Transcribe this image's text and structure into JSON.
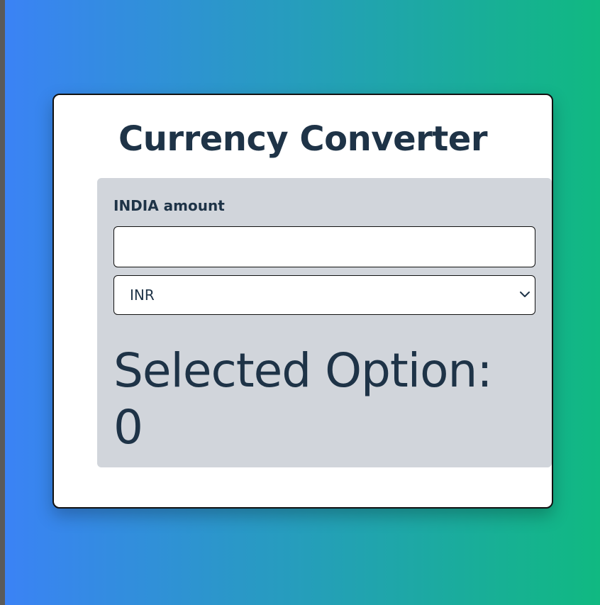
{
  "app": {
    "title": "Currency Converter"
  },
  "converter": {
    "amount_label": "INDIA amount",
    "amount_value": "",
    "currency_selected": "INR",
    "result_label": "Selected Option:",
    "result_value": "0"
  },
  "icons": {
    "select_arrow": "chevron-down-icon"
  },
  "colors": {
    "gradient_start": "#3b82f6",
    "gradient_end": "#10b981",
    "text": "#1e3347",
    "panel": "#d1d5db",
    "card": "#ffffff"
  }
}
